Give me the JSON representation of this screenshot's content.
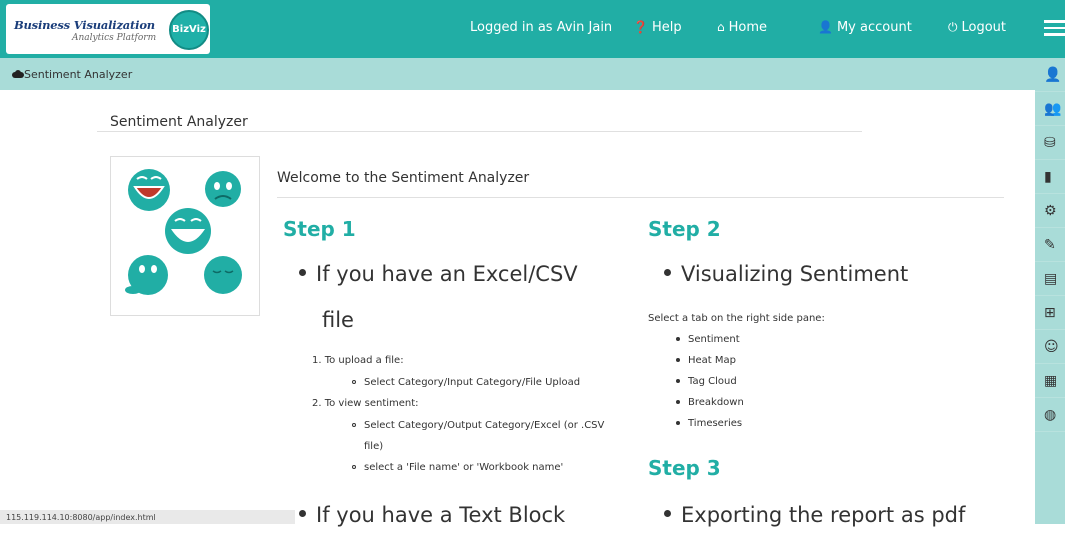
{
  "brand": {
    "title": "Business Visualization",
    "subtitle": "Analytics Platform",
    "logo_text": "BizViz"
  },
  "nav": {
    "logged_in": "Logged in as Avin Jain",
    "help": "Help",
    "home": "Home",
    "account": "My account",
    "logout": "Logout"
  },
  "breadcrumb": {
    "label": "Sentiment Analyzer"
  },
  "page": {
    "title": "Sentiment Analyzer",
    "welcome": "Welcome to the Sentiment Analyzer"
  },
  "step1": {
    "heading": "Step 1",
    "bullet1_line1": "If you have an Excel/CSV",
    "bullet1_line2": "file",
    "item1": "1. To upload a file:",
    "item1_sub": "Select Category/Input Category/File Upload",
    "item2": "2. To view sentiment:",
    "item2_sub1_line1": "Select Category/Output Category/Excel (or .CSV",
    "item2_sub1_line2": "file)",
    "item2_sub2": "select a 'File name' or 'Workbook name'",
    "bullet2": "If you have a Text Block"
  },
  "step2": {
    "heading": "Step 2",
    "bullet": "Visualizing Sentiment",
    "intro": "Select a tab on the right side pane:",
    "tabs": [
      "Sentiment",
      "Heat Map",
      "Tag Cloud",
      "Breakdown",
      "Timeseries"
    ]
  },
  "step3": {
    "heading": "Step 3",
    "bullet": "Exporting the report as pdf"
  },
  "status_url": "115.119.114.10:8080/app/index.html",
  "right_pane_icons": [
    "user-screen-icon",
    "users-group-icon",
    "database-icon",
    "book-icon",
    "upload-settings-icon",
    "edit-icon",
    "document-icon",
    "social-icon",
    "emoji-icon",
    "presentation-icon",
    "globe-icon"
  ],
  "colors": {
    "brand": "#21aea5",
    "subbar": "#a9dcd8",
    "heading": "#21aea5"
  }
}
